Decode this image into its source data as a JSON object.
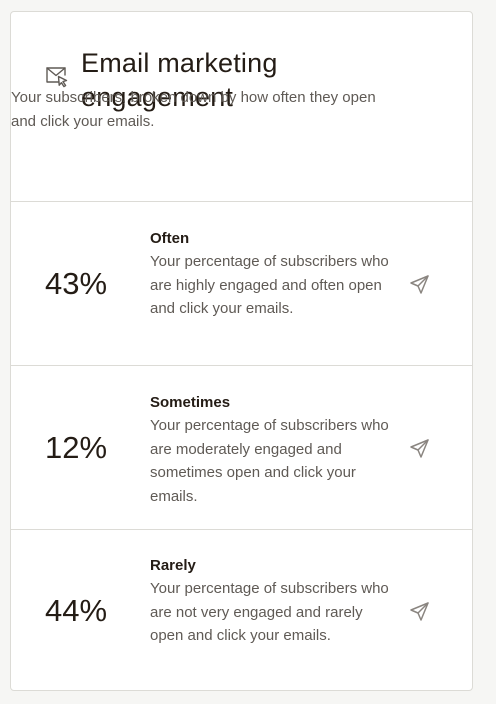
{
  "header": {
    "title": "Email marketing engagement",
    "subtitle": "Your subscribers, broken down by how often they open and click your emails.",
    "icon": "envelope-cursor-icon"
  },
  "rows": [
    {
      "percent": "43%",
      "label": "Often",
      "description": "Your percentage of subscribers who are highly engaged and often open and click your emails.",
      "icon": "paper-plane-icon"
    },
    {
      "percent": "12%",
      "label": "Sometimes",
      "description": "Your percentage of subscribers who are moderately engaged and sometimes open and click your emails.",
      "icon": "paper-plane-icon"
    },
    {
      "percent": "44%",
      "label": "Rarely",
      "description": "Your percentage of subscribers who are not very engaged and rarely open and click your emails.",
      "icon": "paper-plane-icon"
    }
  ],
  "colors": {
    "text": "#241c15",
    "muted": "#5f5a55",
    "icon": "#8a8580",
    "border": "#dcdbd6"
  }
}
